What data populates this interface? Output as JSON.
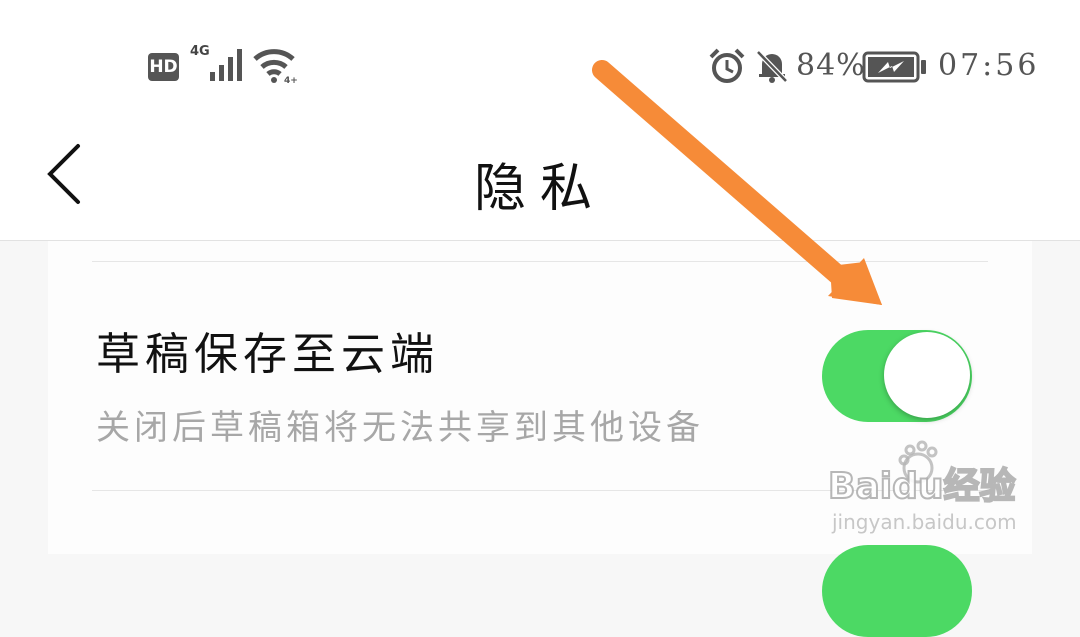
{
  "status_bar": {
    "hd_badge": "HD",
    "network_type": "4G",
    "battery_percent": "84%",
    "time": "07:56",
    "icons": [
      "signal-icon",
      "wifi-icon",
      "alarm-icon",
      "bell-off-icon",
      "battery-charging-icon"
    ]
  },
  "header": {
    "back_icon": "chevron-left-icon",
    "title": "隐私"
  },
  "settings": [
    {
      "title": "草稿保存至云端",
      "description": "关闭后草稿箱将无法共享到其他设备",
      "toggle_on": true
    },
    {
      "toggle_on": true
    }
  ],
  "colors": {
    "toggle_on": "#4cd964",
    "annotation_arrow": "#f68b38"
  },
  "watermark": {
    "logo_text": "Baidu经验",
    "url": "jingyan.baidu.com"
  }
}
